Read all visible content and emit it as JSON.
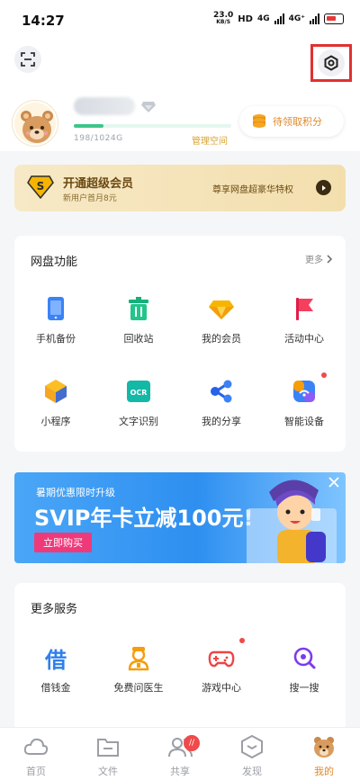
{
  "status_bar": {
    "time": "14:27",
    "net_speed": "23.0",
    "net_unit": "KB/S",
    "hd": "HD",
    "g1": "4G",
    "g2": "4G⁺"
  },
  "header": {
    "scan_icon": "scan-icon",
    "settings_icon": "settings-hexagon-icon",
    "storage": "198/1024G",
    "manage": "管理空间",
    "points": "待领取积分",
    "storage_used_fraction": 0.19
  },
  "vip_banner": {
    "title": "开通超级会员",
    "subtitle": "新用户首月8元",
    "slogan": "尊享网盘超豪华特权"
  },
  "features": {
    "title": "网盘功能",
    "more": "更多",
    "items": [
      {
        "label": "手机备份",
        "icon": "phone-backup-icon"
      },
      {
        "label": "回收站",
        "icon": "recycle-bin-icon"
      },
      {
        "label": "我的会员",
        "icon": "diamond-icon"
      },
      {
        "label": "活动中心",
        "icon": "flag-icon"
      },
      {
        "label": "小程序",
        "icon": "mini-program-icon"
      },
      {
        "label": "文字识别",
        "icon": "ocr-icon",
        "badge": "OCR"
      },
      {
        "label": "我的分享",
        "icon": "share-icon"
      },
      {
        "label": "智能设备",
        "icon": "smart-device-icon"
      }
    ]
  },
  "promo": {
    "line1": "暑期优惠限时升级",
    "line2": "SVIP年卡立减100元!",
    "cta": "立即购买"
  },
  "services": {
    "title": "更多服务",
    "items": [
      {
        "label": "借钱金",
        "icon": "loan-icon",
        "glyph": "借"
      },
      {
        "label": "免费问医生",
        "icon": "doctor-icon"
      },
      {
        "label": "游戏中心",
        "icon": "gamepad-icon"
      },
      {
        "label": "搜一搜",
        "icon": "search-icon"
      }
    ]
  },
  "tabs": [
    {
      "label": "首页",
      "icon": "cloud-icon"
    },
    {
      "label": "文件",
      "icon": "folder-icon"
    },
    {
      "label": "共享",
      "icon": "people-icon",
      "badge": "//"
    },
    {
      "label": "发现",
      "icon": "discover-icon"
    },
    {
      "label": "我的",
      "icon": "bear-avatar-icon"
    }
  ],
  "colors": {
    "accent": "#e08a2e",
    "highlight_box": "#e03131",
    "progress": "#3cc68a",
    "promo_blue": "#2e8ff0",
    "cta_pink": "#ee3a7b"
  }
}
